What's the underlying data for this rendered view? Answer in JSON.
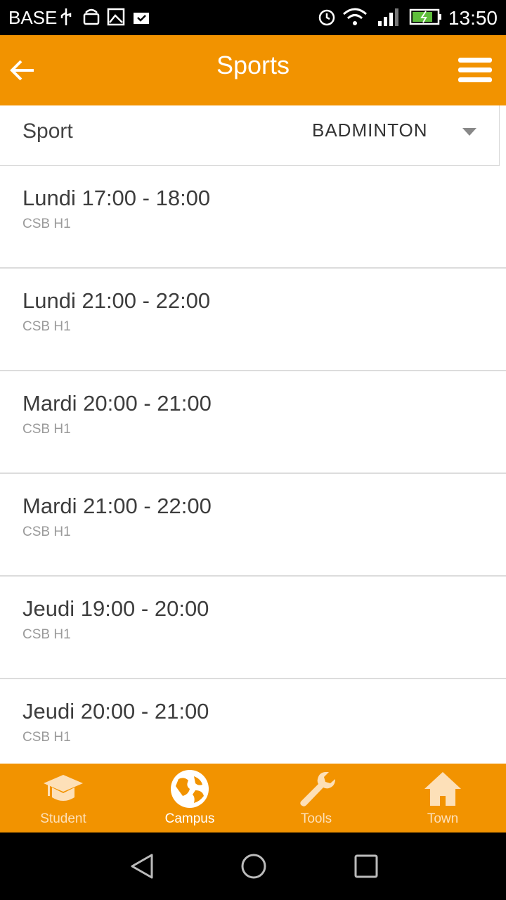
{
  "status_bar": {
    "carrier": "BASE",
    "time": "13:50"
  },
  "app_bar": {
    "title": "Sports"
  },
  "selector": {
    "label": "Sport",
    "value": "BADMINTON"
  },
  "sessions": [
    {
      "time": "Lundi 17:00 - 18:00",
      "place": "CSB H1"
    },
    {
      "time": "Lundi 21:00 - 22:00",
      "place": "CSB H1"
    },
    {
      "time": "Mardi 20:00 - 21:00",
      "place": "CSB H1"
    },
    {
      "time": "Mardi 21:00 - 22:00",
      "place": "CSB H1"
    },
    {
      "time": "Jeudi 19:00 - 20:00",
      "place": "CSB H1"
    },
    {
      "time": "Jeudi 20:00 - 21:00",
      "place": "CSB H1"
    }
  ],
  "bottom_nav": {
    "items": [
      {
        "label": "Student",
        "icon": "graduation-cap-icon"
      },
      {
        "label": "Campus",
        "icon": "globe-icon",
        "active": true
      },
      {
        "label": "Tools",
        "icon": "wrench-icon"
      },
      {
        "label": "Town",
        "icon": "home-icon"
      }
    ]
  },
  "colors": {
    "accent": "#f29300",
    "inactive_nav": "#fde0b8"
  }
}
